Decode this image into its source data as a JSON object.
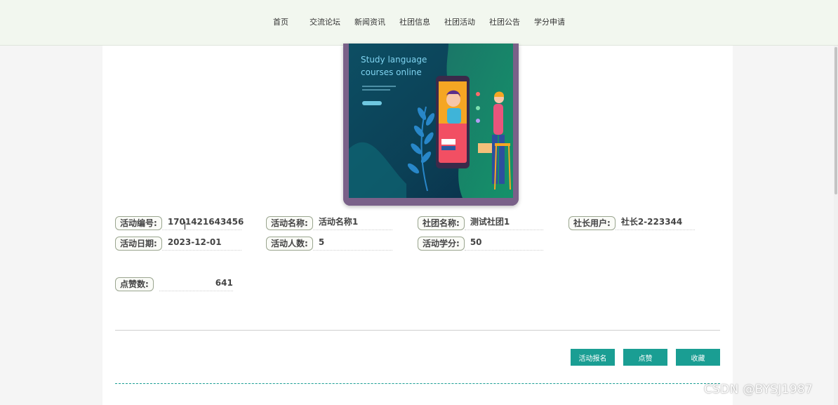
{
  "nav": {
    "items": [
      "首页",
      "交流论坛",
      "新闻资讯",
      "社团信息",
      "社团活动",
      "社团公告",
      "学分申请"
    ]
  },
  "cover": {
    "title_line1": "Study language",
    "title_line2": "courses online"
  },
  "fields": {
    "activity_no": {
      "label": "活动编号:",
      "value": "1701421643456"
    },
    "activity_name": {
      "label": "活动名称:",
      "value": "活动名称1"
    },
    "club_name": {
      "label": "社团名称:",
      "value": "测试社团1"
    },
    "leader_user": {
      "label": "社长用户:",
      "value": "社长2-223344"
    },
    "activity_date": {
      "label": "活动日期:",
      "value": "2023-12-01"
    },
    "participants": {
      "label": "活动人数:",
      "value": "5"
    },
    "credits": {
      "label": "活动学分:",
      "value": "50"
    },
    "likes": {
      "label": "点赞数:",
      "value": "641"
    }
  },
  "actions": {
    "signup": "活动报名",
    "like": "点赞",
    "favorite": "收藏"
  },
  "watermark": "CSDN @BYSJ1987",
  "colors": {
    "accent": "#1a9e93",
    "nav_bg": "#f2f7ef"
  }
}
